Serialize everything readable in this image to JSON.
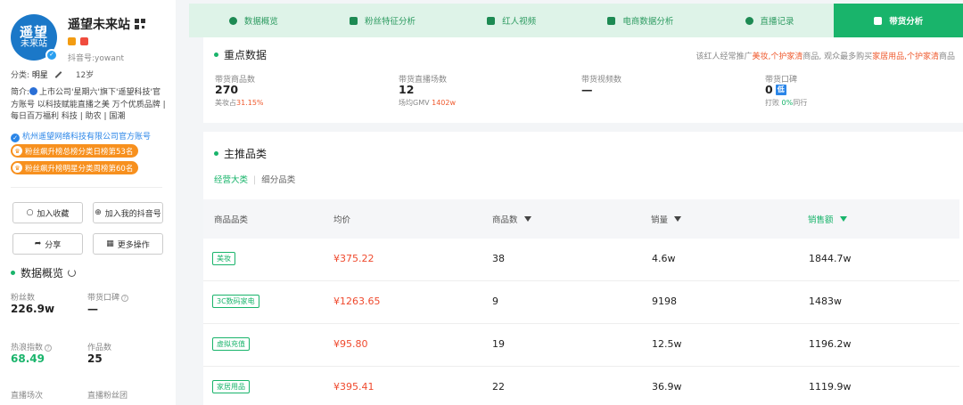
{
  "profile": {
    "avatar_line1": "遥望",
    "avatar_line2": "未来站",
    "name": "遥望未来站",
    "douyin_id": "抖音号:yowant",
    "category_label": "分类:",
    "category_value": "明星",
    "age": "12岁",
    "bio_prefix": "简介:",
    "bio": "上市公司'星期六'旗下'遥望科技'官方账号 以科技赋能直播之美 万个优质品牌 | 每日百万福利 科技 | 助农 | 国潮",
    "company": "杭州遥望网络科技有限公司官方账号",
    "rank_badges": [
      "粉丝飙升榜总榜分类日榜第53名",
      "粉丝飙升榜明星分类周榜第60名"
    ]
  },
  "actions": {
    "favorite": "加入收藏",
    "add_my_account": "加入我的抖音号",
    "share": "分享",
    "more": "更多操作"
  },
  "overview": {
    "title": "数据概览",
    "stats": [
      {
        "label": "粉丝数",
        "value": "226.9w"
      },
      {
        "label": "带货口碑",
        "value": "—"
      },
      {
        "label": "热浪指数",
        "value": "68.49"
      },
      {
        "label": "作品数",
        "value": "25"
      },
      {
        "label": "直播场次",
        "value": ""
      },
      {
        "label": "直播粉丝团",
        "value": ""
      }
    ]
  },
  "tabs": [
    {
      "label": "数据概览",
      "icon": "pie-chart-icon",
      "active": false
    },
    {
      "label": "粉丝特征分析",
      "icon": "user-card-icon",
      "active": false
    },
    {
      "label": "红人视频",
      "icon": "video-camera-icon",
      "active": false
    },
    {
      "label": "电商数据分析",
      "icon": "calendar-icon",
      "active": false
    },
    {
      "label": "直播记录",
      "icon": "clock-icon",
      "active": false
    },
    {
      "label": "带货分析",
      "icon": "shopping-bag-icon",
      "active": true
    }
  ],
  "key_data": {
    "title": "重点数据",
    "note_pre": "该红人经常推广",
    "note_hl1": "美妆,个护家清",
    "note_mid": "商品, 观众最多购买",
    "note_hl2": "家居用品,个护家清",
    "note_post": "商品",
    "items": [
      {
        "label": "带货商品数",
        "value": "270",
        "sub_pre": "美妆占",
        "sub_hl": "31.15%",
        "sub_post": ""
      },
      {
        "label": "带货直播场数",
        "value": "12",
        "sub_pre": "场均GMV",
        "sub_hl": "1402w",
        "sub_post": ""
      },
      {
        "label": "带货视频数",
        "value": "—",
        "sub_pre": "",
        "sub_hl": "",
        "sub_post": ""
      },
      {
        "label": "带货口碑",
        "value": "0",
        "badge": "低",
        "sub_pre": "打败",
        "sub_hl": "0%",
        "sub_post": "同行"
      }
    ]
  },
  "categories": {
    "title": "主推品类",
    "subtabs": [
      "经营大类",
      "细分品类"
    ],
    "columns": [
      "商品品类",
      "均价",
      "商品数",
      "销量",
      "销售额"
    ],
    "rows": [
      {
        "category": "美妆",
        "avg_price": "¥375.22",
        "count": "38",
        "sales": "4.6w",
        "revenue": "1844.7w"
      },
      {
        "category": "3C数码家电",
        "avg_price": "¥1263.65",
        "count": "9",
        "sales": "9198",
        "revenue": "1483w"
      },
      {
        "category": "虚拟充值",
        "avg_price": "¥95.80",
        "count": "19",
        "sales": "12.5w",
        "revenue": "1196.2w"
      },
      {
        "category": "家居用品",
        "avg_price": "¥395.41",
        "count": "22",
        "sales": "36.9w",
        "revenue": "1119.9w"
      }
    ]
  },
  "colors": {
    "accent_green": "#19b46b",
    "tab_bg": "#def3e8",
    "price_red": "#ef4a2e",
    "badge_orange": "#f7901e",
    "link_blue": "#2b86e8"
  }
}
